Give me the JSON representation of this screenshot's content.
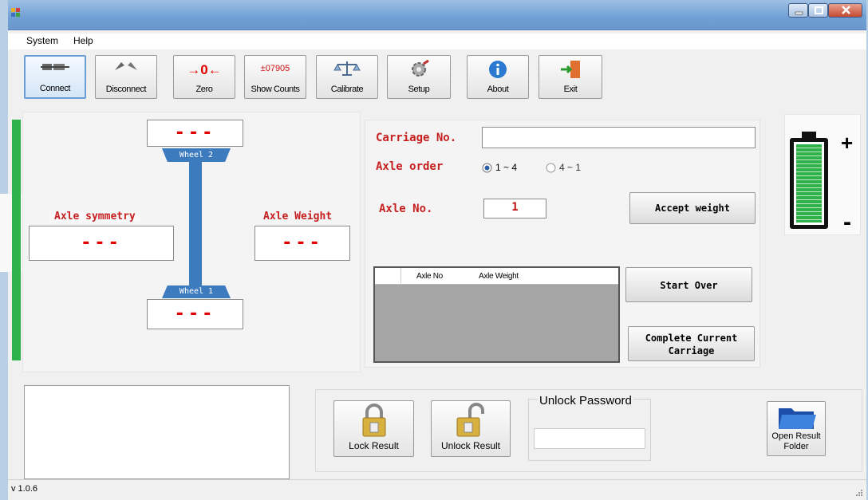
{
  "window": {
    "title": ""
  },
  "menu": {
    "system": "System",
    "help": "Help"
  },
  "toolbar": {
    "connect": "Connect",
    "disconnect": "Disconnect",
    "zero": "Zero",
    "zero_glyph": "→0←",
    "show_counts": "Show Counts",
    "counts_value": "±07905",
    "calibrate": "Calibrate",
    "setup": "Setup",
    "about": "About",
    "exit": "Exit"
  },
  "wheels": {
    "wheel2_label": "Wheel 2",
    "wheel1_label": "Wheel 1",
    "wheel2_value": "---",
    "wheel1_value": "---"
  },
  "axle_symmetry": {
    "label": "Axle symmetry",
    "value": "---"
  },
  "axle_weight": {
    "label": "Axle Weight",
    "value": "---"
  },
  "form": {
    "carriage_label": "Carriage No.",
    "carriage_value": "",
    "axle_order_label": "Axle order",
    "order_option_1": "1 ~ 4",
    "order_option_2": "4 ~ 1",
    "order_selected": "1 ~ 4",
    "axle_no_label": "Axle No.",
    "axle_no_value": "1",
    "accept_weight": "Accept weight",
    "start_over": "Start Over",
    "complete_carriage": "Complete Current Carriage"
  },
  "grid": {
    "columns": [
      "Axle No",
      "Axle Weight"
    ],
    "rows": []
  },
  "battery": {
    "plus": "+",
    "minus": "-",
    "level": 1.0,
    "fill_color": "#2fb24a"
  },
  "result": {
    "lock": "Lock Result",
    "unlock": "Unlock Result",
    "unlock_password_label": "Unlock Password",
    "unlock_password_value": "",
    "open_folder": "Open Result Folder"
  },
  "status": {
    "version": "v 1.0.6"
  },
  "colors": {
    "accent_red": "#e00000",
    "wheel_blue": "#3d7bbf",
    "status_green": "#2fb24a"
  }
}
